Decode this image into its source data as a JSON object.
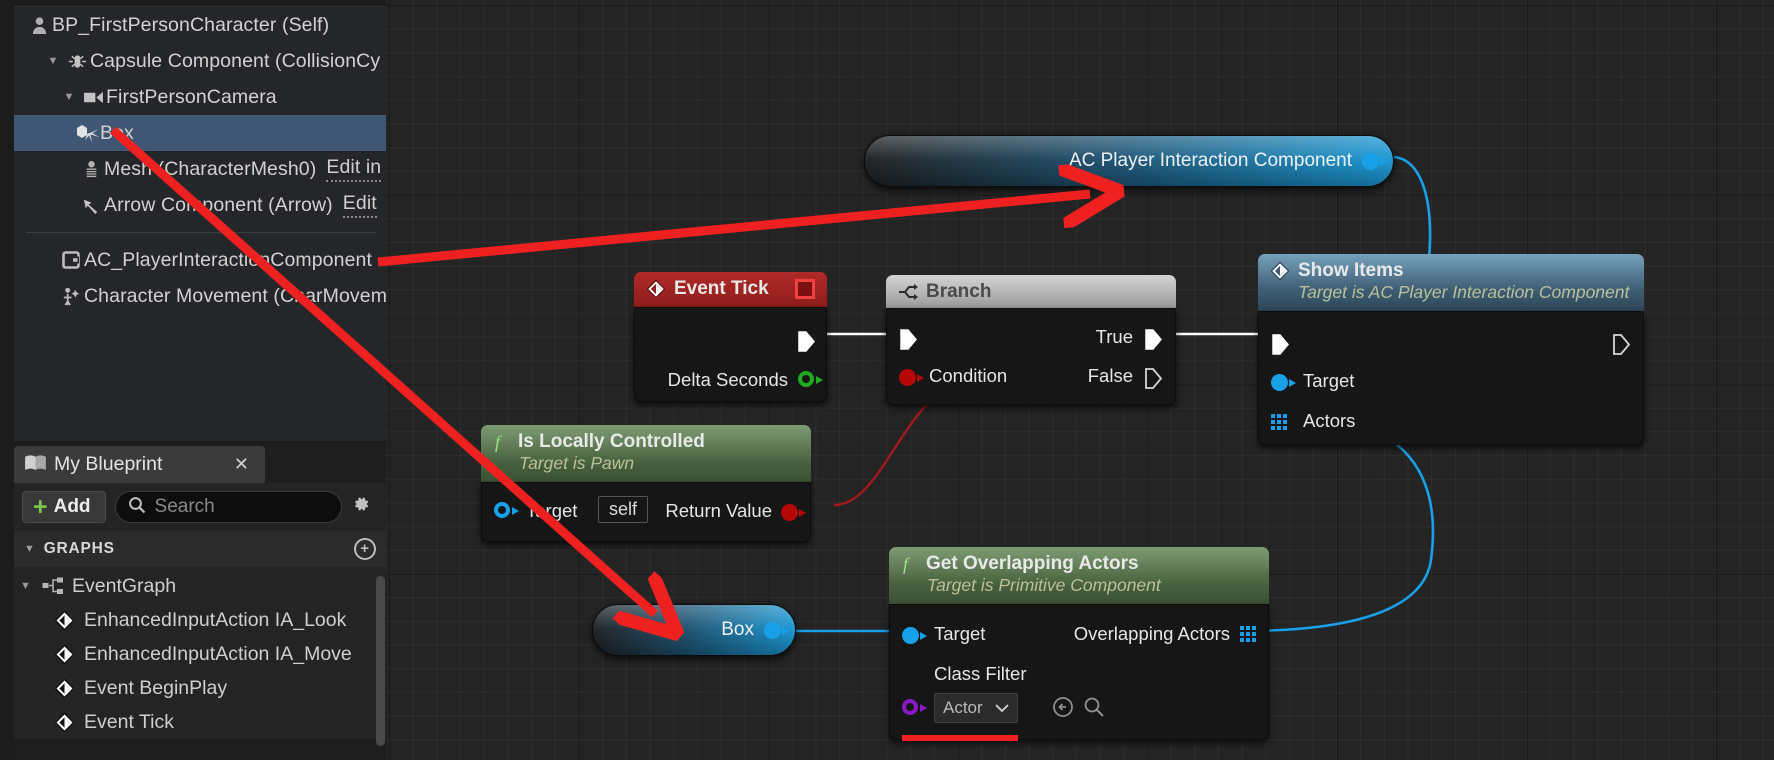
{
  "components_panel": {
    "rows": [
      {
        "label": "BP_FirstPersonCharacter (Self)",
        "icon": "character-icon",
        "indent": 0,
        "arrow": "",
        "selected": false,
        "edit": ""
      },
      {
        "label": "Capsule Component (CollisionCy",
        "icon": "capsule-icon",
        "indent": 1,
        "arrow": "▼",
        "selected": false,
        "edit": ""
      },
      {
        "label": "FirstPersonCamera",
        "icon": "camera-icon",
        "indent": 2,
        "arrow": "▼",
        "selected": false,
        "edit": ""
      },
      {
        "label": "Box",
        "icon": "box-collision-icon",
        "indent": 3,
        "arrow": "",
        "selected": true,
        "edit": ""
      },
      {
        "label": "Mesh (CharacterMesh0)",
        "icon": "skeletal-mesh-icon",
        "indent": 3,
        "arrow": "",
        "selected": false,
        "edit": "Edit in"
      },
      {
        "label": "Arrow Component (Arrow)",
        "icon": "arrow-component-icon",
        "indent": 3,
        "arrow": "",
        "selected": false,
        "edit": "Edit"
      }
    ],
    "rows_after_separator": [
      {
        "label": "AC_PlayerInteractionComponent",
        "icon": "actor-component-icon",
        "indent": 1,
        "arrow": "",
        "selected": false,
        "edit": ""
      },
      {
        "label": "Character Movement (CharMovem",
        "icon": "character-movement-icon",
        "indent": 1,
        "arrow": "",
        "selected": false,
        "edit": ""
      }
    ]
  },
  "my_blueprint": {
    "tab_label": "My Blueprint",
    "tab_icon": "book-icon",
    "close_label": "✕",
    "add_label": "Add",
    "add_plus": "+",
    "search_placeholder": "Search",
    "search_value": "",
    "search_icon": "search-icon",
    "settings_icon": "gear-icon",
    "section_header": "GRAPHS",
    "section_add_icon": "plus-circle-icon",
    "items": [
      {
        "label": "EventGraph",
        "icon": "graph-icon",
        "level": 0,
        "arrow": "▼"
      },
      {
        "label": "EnhancedInputAction IA_Look",
        "icon": "event-node-icon",
        "level": 1,
        "arrow": ""
      },
      {
        "label": "EnhancedInputAction IA_Move",
        "icon": "event-node-icon",
        "level": 1,
        "arrow": ""
      },
      {
        "label": "Event BeginPlay",
        "icon": "event-node-icon",
        "level": 1,
        "arrow": ""
      },
      {
        "label": "Event Tick",
        "icon": "event-node-icon",
        "level": 1,
        "arrow": ""
      }
    ]
  },
  "graph": {
    "nodes": {
      "ac_player_interaction_component": {
        "title": "AC Player Interaction Component",
        "type": "variable-get",
        "output_pin": "component-out"
      },
      "event_tick": {
        "title": "Event Tick",
        "icon": "event-diamond-icon",
        "badge_icon": "red-square-icon",
        "pins": {
          "exec_out": "",
          "delta_seconds": "Delta Seconds"
        }
      },
      "branch": {
        "title": "Branch",
        "icon": "branch-icon",
        "pins": {
          "exec_in": "",
          "condition": "Condition",
          "true": "True",
          "false": "False"
        }
      },
      "show_items": {
        "title": "Show Items",
        "subtitle": "Target is AC Player Interaction Component",
        "icon": "event-diamond-icon",
        "pins": {
          "exec_in": "",
          "exec_out": "",
          "target": "Target",
          "actors": "Actors"
        }
      },
      "is_locally_controlled": {
        "title": "Is Locally Controlled",
        "subtitle": "Target is Pawn",
        "icon": "function-f-icon",
        "pins": {
          "target": "Target",
          "target_value": "self",
          "return_value": "Return Value"
        }
      },
      "get_overlapping_actors": {
        "title": "Get Overlapping Actors",
        "subtitle": "Target is Primitive Component",
        "icon": "function-f-icon",
        "pins": {
          "target": "Target",
          "overlapping_actors": "Overlapping Actors",
          "class_filter": "Class Filter",
          "class_filter_value": "Actor",
          "class_filter_caret": "⌄",
          "reset_icon": "reset-arrow-icon",
          "browse_icon": "search-icon"
        }
      },
      "box": {
        "title": "Box",
        "type": "variable-get",
        "output_pin": "box-out"
      }
    },
    "colors": {
      "exec_wire": "#ffffff",
      "object_wire": "#18a0e8",
      "bool_wire": "#a01a1a",
      "annotation": "#ef2020",
      "selected_row": "#3f5675",
      "accent_green": "#79c64b"
    }
  }
}
